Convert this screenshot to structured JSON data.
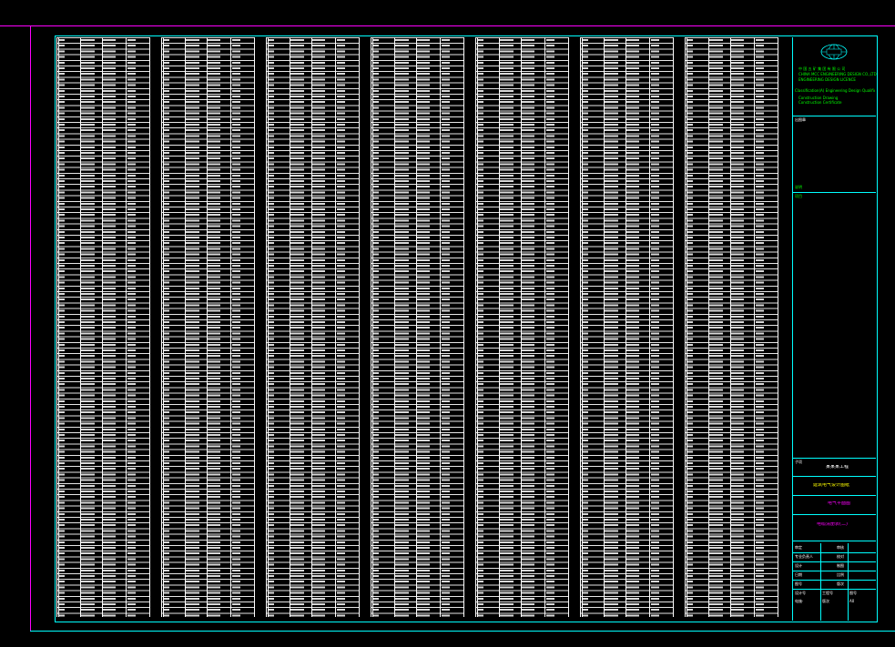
{
  "drawing": {
    "layout": {
      "column_count": 7,
      "rows_per_column": 103
    },
    "colors": {
      "background": "#000000",
      "frame": "#00ffff",
      "outer_frame": "#ff00ff",
      "table_lines": "#ffffff"
    },
    "title_block": {
      "company_cn": "中 国 五 矿 集 团 有 限 公 司",
      "company_en": "CHINA MCC ENGINEERING DESIGN CO.,LTD",
      "approval": "ENGINEERING DESIGN LICENCE",
      "note_line": "Classification(A)  Engineering  Design  Qualification  Certificate",
      "project_label": "项目",
      "drawing_label": "子项",
      "cert_line_1": "Construction  Drawing",
      "cert_line_2": "Construction  Certificate",
      "stamp_label": "出图章",
      "revision_note": "说明",
      "sheet_title_1": "某某某工程",
      "sheet_title_2": "建筑电气设计图纸",
      "sheet_title_3": "电气平面图",
      "sheet_title_4": "电缆清册表(二)",
      "sig_rows": [
        {
          "label": "审定",
          "value": "审核"
        },
        {
          "label": "专业负责人",
          "value": "校对"
        },
        {
          "label": "设计",
          "value": "制图"
        },
        {
          "label": "日期",
          "value": "比例"
        },
        {
          "label": "图号",
          "value": "版次"
        }
      ],
      "bottom_cells": [
        "设计号",
        "工程号",
        "图号",
        "电施-",
        "版次",
        "A0"
      ]
    }
  }
}
